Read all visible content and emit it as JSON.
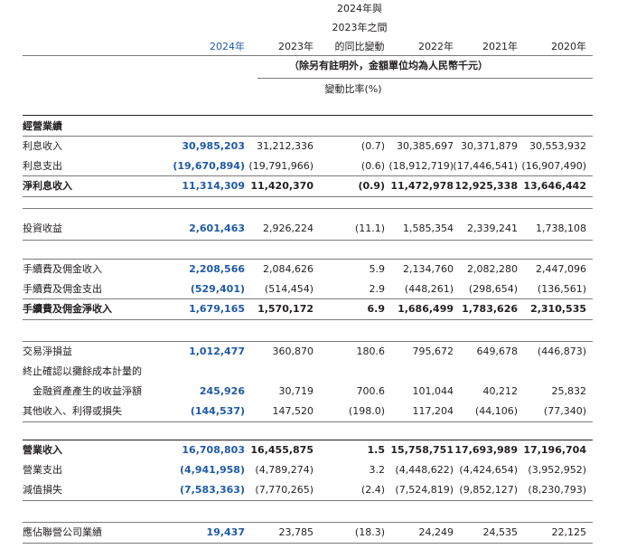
{
  "header": {
    "diff_l1": "2024年與",
    "diff_l2": "2023年之間",
    "diff_l3": "的同比變動",
    "y2024": "2024年",
    "y2023": "2023年",
    "y2022": "2022年",
    "y2021": "2021年",
    "y2020": "2020年",
    "unit_note": "（除另有註明外，金額單位均為人民幣千元）",
    "pct_note": "變動比率(%)"
  },
  "rows": [
    {
      "label": "經營業績",
      "section": true
    },
    {
      "label": "利息收入",
      "v2024": "30,985,203",
      "v2023": "31,212,336",
      "chg": "(0.7)",
      "v2022": "30,385,697",
      "v2021": "30,371,879",
      "v2020": "30,553,932"
    },
    {
      "label": "利息支出",
      "v2024": "(19,670,894)",
      "v2023": "(19,791,966)",
      "chg": "(0.6)",
      "v2022": "(18,912,719)",
      "v2021": "(17,446,541)",
      "v2020": "(16,907,490)"
    },
    {
      "label": "淨利息收入",
      "bold": true,
      "v2024": "11,314,309",
      "v2023": "11,420,370",
      "chg": "(0.9)",
      "v2022": "11,472,978",
      "v2021": "12,925,338",
      "v2020": "13,646,442"
    },
    {
      "label": "投資收益",
      "v2024": "2,601,463",
      "v2023": "2,926,224",
      "chg": "(11.1)",
      "v2022": "1,585,354",
      "v2021": "2,339,241",
      "v2020": "1,738,108"
    },
    {
      "label": "手續費及佣金收入",
      "v2024": "2,208,566",
      "v2023": "2,084,626",
      "chg": "5.9",
      "v2022": "2,134,760",
      "v2021": "2,082,280",
      "v2020": "2,447,096"
    },
    {
      "label": "手續費及佣金支出",
      "v2024": "(529,401)",
      "v2023": "(514,454)",
      "chg": "2.9",
      "v2022": "(448,261)",
      "v2021": "(298,654)",
      "v2020": "(136,561)"
    },
    {
      "label": "手續費及佣金淨收入",
      "bold": true,
      "v2024": "1,679,165",
      "v2023": "1,570,172",
      "chg": "6.9",
      "v2022": "1,686,499",
      "v2021": "1,783,626",
      "v2020": "2,310,535"
    },
    {
      "label": "交易淨損益",
      "v2024": "1,012,477",
      "v2023": "360,870",
      "chg": "180.6",
      "v2022": "795,672",
      "v2021": "649,678",
      "v2020": "(446,873)"
    },
    {
      "label": "終止確認以攤餘成本計量的",
      "section": true,
      "plain": true
    },
    {
      "label": "金融資產產生的收益淨額",
      "indent": true,
      "v2024": "245,926",
      "v2023": "30,719",
      "chg": "700.6",
      "v2022": "101,044",
      "v2021": "40,212",
      "v2020": "25,832"
    },
    {
      "label": "其他收入、利得或損失",
      "v2024": "(144,537)",
      "v2023": "147,520",
      "chg": "(198.0)",
      "v2022": "117,204",
      "v2021": "(44,106)",
      "v2020": "(77,340)"
    },
    {
      "label": "營業收入",
      "bold": true,
      "v2024": "16,708,803",
      "v2023": "16,455,875",
      "chg": "1.5",
      "v2022": "15,758,751",
      "v2021": "17,693,989",
      "v2020": "17,196,704"
    },
    {
      "label": "營業支出",
      "v2024": "(4,941,958)",
      "v2023": "(4,789,274)",
      "chg": "3.2",
      "v2022": "(4,448,622)",
      "v2021": "(4,424,654)",
      "v2020": "(3,952,952)"
    },
    {
      "label": "減值損失",
      "v2024": "(7,583,363)",
      "v2023": "(7,770,265)",
      "chg": "(2.4)",
      "v2022": "(7,524,819)",
      "v2021": "(9,852,127)",
      "v2020": "(8,230,793)"
    },
    {
      "label": "應佔聯營公司業績",
      "v2024": "19,437",
      "v2023": "23,785",
      "chg": "(18.3)",
      "v2022": "24,249",
      "v2021": "24,535",
      "v2020": "22,125"
    }
  ]
}
